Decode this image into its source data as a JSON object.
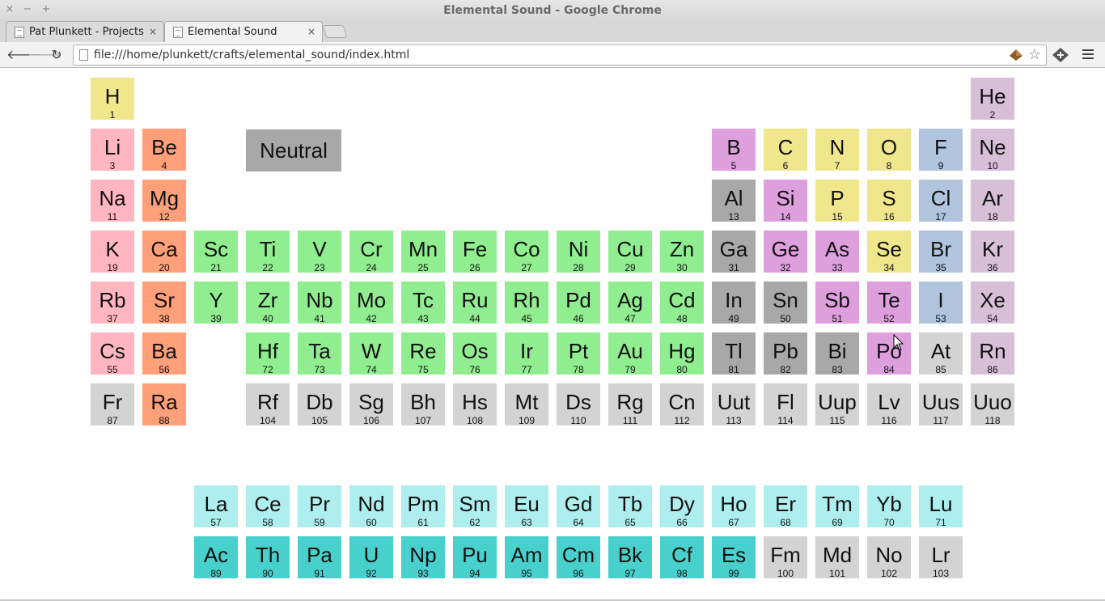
{
  "window": {
    "title": "Elemental Sound - Google Chrome",
    "controls": [
      "×",
      "−",
      "+"
    ]
  },
  "tabs": [
    {
      "label": "Pat Plunkett - Projects",
      "close": "×",
      "active": false
    },
    {
      "label": "Elemental Sound",
      "close": "×",
      "active": true
    }
  ],
  "toolbar": {
    "url": "file:///home/plunkett/crafts/elemental_sound/index.html",
    "back_icon": "arrow-left-icon",
    "forward_icon": "arrow-right-icon",
    "reload_icon": "reload-icon"
  },
  "legend": {
    "label": "Neutral",
    "color": "#a8a8a8"
  },
  "colors": {
    "alkali": "#ffb6c1",
    "alkaline": "#ffa07a",
    "transition": "#90ee90",
    "metal": "#a8a8a8",
    "metalloid": "#dda0dd",
    "nonmetal": "#f0e68c",
    "halogen": "#b0c4de",
    "noble": "#d8bfd8",
    "lanthanide": "#afeeee",
    "actinide": "#48d1cc",
    "unknown": "#d3d3d3"
  },
  "elements": [
    {
      "s": "H",
      "n": 1,
      "c": "nonmetal",
      "r": 1,
      "col": 1
    },
    {
      "s": "He",
      "n": 2,
      "c": "noble",
      "r": 1,
      "col": 18
    },
    {
      "s": "Li",
      "n": 3,
      "c": "alkali",
      "r": 2,
      "col": 1
    },
    {
      "s": "Be",
      "n": 4,
      "c": "alkaline",
      "r": 2,
      "col": 2
    },
    {
      "s": "B",
      "n": 5,
      "c": "metalloid",
      "r": 2,
      "col": 13
    },
    {
      "s": "C",
      "n": 6,
      "c": "nonmetal",
      "r": 2,
      "col": 14
    },
    {
      "s": "N",
      "n": 7,
      "c": "nonmetal",
      "r": 2,
      "col": 15
    },
    {
      "s": "O",
      "n": 8,
      "c": "nonmetal",
      "r": 2,
      "col": 16
    },
    {
      "s": "F",
      "n": 9,
      "c": "halogen",
      "r": 2,
      "col": 17
    },
    {
      "s": "Ne",
      "n": 10,
      "c": "noble",
      "r": 2,
      "col": 18
    },
    {
      "s": "Na",
      "n": 11,
      "c": "alkali",
      "r": 3,
      "col": 1
    },
    {
      "s": "Mg",
      "n": 12,
      "c": "alkaline",
      "r": 3,
      "col": 2
    },
    {
      "s": "Al",
      "n": 13,
      "c": "metal",
      "r": 3,
      "col": 13
    },
    {
      "s": "Si",
      "n": 14,
      "c": "metalloid",
      "r": 3,
      "col": 14
    },
    {
      "s": "P",
      "n": 15,
      "c": "nonmetal",
      "r": 3,
      "col": 15
    },
    {
      "s": "S",
      "n": 16,
      "c": "nonmetal",
      "r": 3,
      "col": 16
    },
    {
      "s": "Cl",
      "n": 17,
      "c": "halogen",
      "r": 3,
      "col": 17
    },
    {
      "s": "Ar",
      "n": 18,
      "c": "noble",
      "r": 3,
      "col": 18
    },
    {
      "s": "K",
      "n": 19,
      "c": "alkali",
      "r": 4,
      "col": 1
    },
    {
      "s": "Ca",
      "n": 20,
      "c": "alkaline",
      "r": 4,
      "col": 2
    },
    {
      "s": "Sc",
      "n": 21,
      "c": "transition",
      "r": 4,
      "col": 3
    },
    {
      "s": "Ti",
      "n": 22,
      "c": "transition",
      "r": 4,
      "col": 4
    },
    {
      "s": "V",
      "n": 23,
      "c": "transition",
      "r": 4,
      "col": 5
    },
    {
      "s": "Cr",
      "n": 24,
      "c": "transition",
      "r": 4,
      "col": 6
    },
    {
      "s": "Mn",
      "n": 25,
      "c": "transition",
      "r": 4,
      "col": 7
    },
    {
      "s": "Fe",
      "n": 26,
      "c": "transition",
      "r": 4,
      "col": 8
    },
    {
      "s": "Co",
      "n": 27,
      "c": "transition",
      "r": 4,
      "col": 9
    },
    {
      "s": "Ni",
      "n": 28,
      "c": "transition",
      "r": 4,
      "col": 10
    },
    {
      "s": "Cu",
      "n": 29,
      "c": "transition",
      "r": 4,
      "col": 11
    },
    {
      "s": "Zn",
      "n": 30,
      "c": "transition",
      "r": 4,
      "col": 12
    },
    {
      "s": "Ga",
      "n": 31,
      "c": "metal",
      "r": 4,
      "col": 13
    },
    {
      "s": "Ge",
      "n": 32,
      "c": "metalloid",
      "r": 4,
      "col": 14
    },
    {
      "s": "As",
      "n": 33,
      "c": "metalloid",
      "r": 4,
      "col": 15
    },
    {
      "s": "Se",
      "n": 34,
      "c": "nonmetal",
      "r": 4,
      "col": 16
    },
    {
      "s": "Br",
      "n": 35,
      "c": "halogen",
      "r": 4,
      "col": 17
    },
    {
      "s": "Kr",
      "n": 36,
      "c": "noble",
      "r": 4,
      "col": 18
    },
    {
      "s": "Rb",
      "n": 37,
      "c": "alkali",
      "r": 5,
      "col": 1
    },
    {
      "s": "Sr",
      "n": 38,
      "c": "alkaline",
      "r": 5,
      "col": 2
    },
    {
      "s": "Y",
      "n": 39,
      "c": "transition",
      "r": 5,
      "col": 3
    },
    {
      "s": "Zr",
      "n": 40,
      "c": "transition",
      "r": 5,
      "col": 4
    },
    {
      "s": "Nb",
      "n": 41,
      "c": "transition",
      "r": 5,
      "col": 5
    },
    {
      "s": "Mo",
      "n": 42,
      "c": "transition",
      "r": 5,
      "col": 6
    },
    {
      "s": "Tc",
      "n": 43,
      "c": "transition",
      "r": 5,
      "col": 7
    },
    {
      "s": "Ru",
      "n": 44,
      "c": "transition",
      "r": 5,
      "col": 8
    },
    {
      "s": "Rh",
      "n": 45,
      "c": "transition",
      "r": 5,
      "col": 9
    },
    {
      "s": "Pd",
      "n": 46,
      "c": "transition",
      "r": 5,
      "col": 10
    },
    {
      "s": "Ag",
      "n": 47,
      "c": "transition",
      "r": 5,
      "col": 11
    },
    {
      "s": "Cd",
      "n": 48,
      "c": "transition",
      "r": 5,
      "col": 12
    },
    {
      "s": "In",
      "n": 49,
      "c": "metal",
      "r": 5,
      "col": 13
    },
    {
      "s": "Sn",
      "n": 50,
      "c": "metal",
      "r": 5,
      "col": 14
    },
    {
      "s": "Sb",
      "n": 51,
      "c": "metalloid",
      "r": 5,
      "col": 15
    },
    {
      "s": "Te",
      "n": 52,
      "c": "metalloid",
      "r": 5,
      "col": 16
    },
    {
      "s": "I",
      "n": 53,
      "c": "halogen",
      "r": 5,
      "col": 17
    },
    {
      "s": "Xe",
      "n": 54,
      "c": "noble",
      "r": 5,
      "col": 18
    },
    {
      "s": "Cs",
      "n": 55,
      "c": "alkali",
      "r": 6,
      "col": 1
    },
    {
      "s": "Ba",
      "n": 56,
      "c": "alkaline",
      "r": 6,
      "col": 2
    },
    {
      "s": "Hf",
      "n": 72,
      "c": "transition",
      "r": 6,
      "col": 4
    },
    {
      "s": "Ta",
      "n": 73,
      "c": "transition",
      "r": 6,
      "col": 5
    },
    {
      "s": "W",
      "n": 74,
      "c": "transition",
      "r": 6,
      "col": 6
    },
    {
      "s": "Re",
      "n": 75,
      "c": "transition",
      "r": 6,
      "col": 7
    },
    {
      "s": "Os",
      "n": 76,
      "c": "transition",
      "r": 6,
      "col": 8
    },
    {
      "s": "Ir",
      "n": 77,
      "c": "transition",
      "r": 6,
      "col": 9
    },
    {
      "s": "Pt",
      "n": 78,
      "c": "transition",
      "r": 6,
      "col": 10
    },
    {
      "s": "Au",
      "n": 79,
      "c": "transition",
      "r": 6,
      "col": 11
    },
    {
      "s": "Hg",
      "n": 80,
      "c": "transition",
      "r": 6,
      "col": 12
    },
    {
      "s": "Tl",
      "n": 81,
      "c": "metal",
      "r": 6,
      "col": 13
    },
    {
      "s": "Pb",
      "n": 82,
      "c": "metal",
      "r": 6,
      "col": 14
    },
    {
      "s": "Bi",
      "n": 83,
      "c": "metal",
      "r": 6,
      "col": 15
    },
    {
      "s": "Po",
      "n": 84,
      "c": "metalloid",
      "r": 6,
      "col": 16
    },
    {
      "s": "At",
      "n": 85,
      "c": "unknown",
      "r": 6,
      "col": 17
    },
    {
      "s": "Rn",
      "n": 86,
      "c": "noble",
      "r": 6,
      "col": 18
    },
    {
      "s": "Fr",
      "n": 87,
      "c": "unknown",
      "r": 7,
      "col": 1
    },
    {
      "s": "Ra",
      "n": 88,
      "c": "alkaline",
      "r": 7,
      "col": 2
    },
    {
      "s": "Rf",
      "n": 104,
      "c": "unknown",
      "r": 7,
      "col": 4
    },
    {
      "s": "Db",
      "n": 105,
      "c": "unknown",
      "r": 7,
      "col": 5
    },
    {
      "s": "Sg",
      "n": 106,
      "c": "unknown",
      "r": 7,
      "col": 6
    },
    {
      "s": "Bh",
      "n": 107,
      "c": "unknown",
      "r": 7,
      "col": 7
    },
    {
      "s": "Hs",
      "n": 108,
      "c": "unknown",
      "r": 7,
      "col": 8
    },
    {
      "s": "Mt",
      "n": 109,
      "c": "unknown",
      "r": 7,
      "col": 9
    },
    {
      "s": "Ds",
      "n": 110,
      "c": "unknown",
      "r": 7,
      "col": 10
    },
    {
      "s": "Rg",
      "n": 111,
      "c": "unknown",
      "r": 7,
      "col": 11
    },
    {
      "s": "Cn",
      "n": 112,
      "c": "unknown",
      "r": 7,
      "col": 12
    },
    {
      "s": "Uut",
      "n": 113,
      "c": "unknown",
      "r": 7,
      "col": 13
    },
    {
      "s": "Fl",
      "n": 114,
      "c": "unknown",
      "r": 7,
      "col": 14
    },
    {
      "s": "Uup",
      "n": 115,
      "c": "unknown",
      "r": 7,
      "col": 15
    },
    {
      "s": "Lv",
      "n": 116,
      "c": "unknown",
      "r": 7,
      "col": 16
    },
    {
      "s": "Uus",
      "n": 117,
      "c": "unknown",
      "r": 7,
      "col": 17
    },
    {
      "s": "Uuo",
      "n": 118,
      "c": "unknown",
      "r": 7,
      "col": 18
    },
    {
      "s": "La",
      "n": 57,
      "c": "lanthanide",
      "r": 9,
      "col": 3
    },
    {
      "s": "Ce",
      "n": 58,
      "c": "lanthanide",
      "r": 9,
      "col": 4
    },
    {
      "s": "Pr",
      "n": 59,
      "c": "lanthanide",
      "r": 9,
      "col": 5
    },
    {
      "s": "Nd",
      "n": 60,
      "c": "lanthanide",
      "r": 9,
      "col": 6
    },
    {
      "s": "Pm",
      "n": 61,
      "c": "lanthanide",
      "r": 9,
      "col": 7
    },
    {
      "s": "Sm",
      "n": 62,
      "c": "lanthanide",
      "r": 9,
      "col": 8
    },
    {
      "s": "Eu",
      "n": 63,
      "c": "lanthanide",
      "r": 9,
      "col": 9
    },
    {
      "s": "Gd",
      "n": 64,
      "c": "lanthanide",
      "r": 9,
      "col": 10
    },
    {
      "s": "Tb",
      "n": 65,
      "c": "lanthanide",
      "r": 9,
      "col": 11
    },
    {
      "s": "Dy",
      "n": 66,
      "c": "lanthanide",
      "r": 9,
      "col": 12
    },
    {
      "s": "Ho",
      "n": 67,
      "c": "lanthanide",
      "r": 9,
      "col": 13
    },
    {
      "s": "Er",
      "n": 68,
      "c": "lanthanide",
      "r": 9,
      "col": 14
    },
    {
      "s": "Tm",
      "n": 69,
      "c": "lanthanide",
      "r": 9,
      "col": 15
    },
    {
      "s": "Yb",
      "n": 70,
      "c": "lanthanide",
      "r": 9,
      "col": 16
    },
    {
      "s": "Lu",
      "n": 71,
      "c": "lanthanide",
      "r": 9,
      "col": 17
    },
    {
      "s": "Ac",
      "n": 89,
      "c": "actinide",
      "r": 10,
      "col": 3
    },
    {
      "s": "Th",
      "n": 90,
      "c": "actinide",
      "r": 10,
      "col": 4
    },
    {
      "s": "Pa",
      "n": 91,
      "c": "actinide",
      "r": 10,
      "col": 5
    },
    {
      "s": "U",
      "n": 92,
      "c": "actinide",
      "r": 10,
      "col": 6
    },
    {
      "s": "Np",
      "n": 93,
      "c": "actinide",
      "r": 10,
      "col": 7
    },
    {
      "s": "Pu",
      "n": 94,
      "c": "actinide",
      "r": 10,
      "col": 8
    },
    {
      "s": "Am",
      "n": 95,
      "c": "actinide",
      "r": 10,
      "col": 9
    },
    {
      "s": "Cm",
      "n": 96,
      "c": "actinide",
      "r": 10,
      "col": 10
    },
    {
      "s": "Bk",
      "n": 97,
      "c": "actinide",
      "r": 10,
      "col": 11
    },
    {
      "s": "Cf",
      "n": 98,
      "c": "actinide",
      "r": 10,
      "col": 12
    },
    {
      "s": "Es",
      "n": 99,
      "c": "actinide",
      "r": 10,
      "col": 13
    },
    {
      "s": "Fm",
      "n": 100,
      "c": "unknown",
      "r": 10,
      "col": 14
    },
    {
      "s": "Md",
      "n": 101,
      "c": "unknown",
      "r": 10,
      "col": 15
    },
    {
      "s": "No",
      "n": 102,
      "c": "unknown",
      "r": 10,
      "col": 16
    },
    {
      "s": "Lr",
      "n": 103,
      "c": "unknown",
      "r": 10,
      "col": 17
    }
  ]
}
